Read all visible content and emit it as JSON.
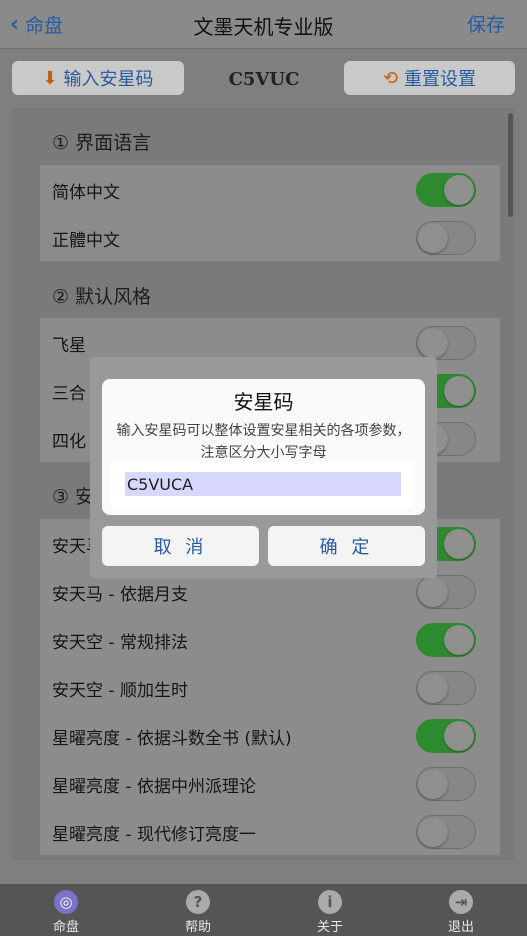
{
  "nav": {
    "back_label": "命盘",
    "title": "文墨天机专业版",
    "save_label": "保存"
  },
  "toolbar": {
    "input_code_label": "输入安星码",
    "code": "C5VUC",
    "reset_label": "重置设置"
  },
  "sections": [
    {
      "title": "① 界面语言",
      "rows": [
        {
          "label": "简体中文",
          "on": true
        },
        {
          "label": "正體中文",
          "on": false
        }
      ]
    },
    {
      "title": "② 默认风格",
      "rows": [
        {
          "label": "飞星",
          "on": false
        },
        {
          "label": "三合 (",
          "on": true
        },
        {
          "label": "四化",
          "on": false
        }
      ]
    },
    {
      "title": "③ 安",
      "rows": [
        {
          "label": "安天马",
          "on": true
        },
        {
          "label": "安天马 - 依据月支",
          "on": false
        },
        {
          "label": "安天空 - 常规排法",
          "on": true
        },
        {
          "label": "安天空 - 顺加生时",
          "on": false
        },
        {
          "label": "星曜亮度 - 依据斗数全书 (默认)",
          "on": true
        },
        {
          "label": "星曜亮度 - 依据中州派理论",
          "on": false
        },
        {
          "label": "星曜亮度 - 现代修订亮度一",
          "on": false
        }
      ]
    }
  ],
  "dialog": {
    "title": "安星码",
    "message": "输入安星码可以整体设置安星相关的各项参数，注意区分大小写字母",
    "input_value": "C5VUCA",
    "cancel_label": "取 消",
    "ok_label": "确 定"
  },
  "tabs": [
    {
      "label": "命盘",
      "icon": "target-icon",
      "active": true
    },
    {
      "label": "帮助",
      "icon": "help-icon",
      "active": false
    },
    {
      "label": "关于",
      "icon": "info-icon",
      "active": false
    },
    {
      "label": "退出",
      "icon": "exit-icon",
      "active": false
    }
  ]
}
